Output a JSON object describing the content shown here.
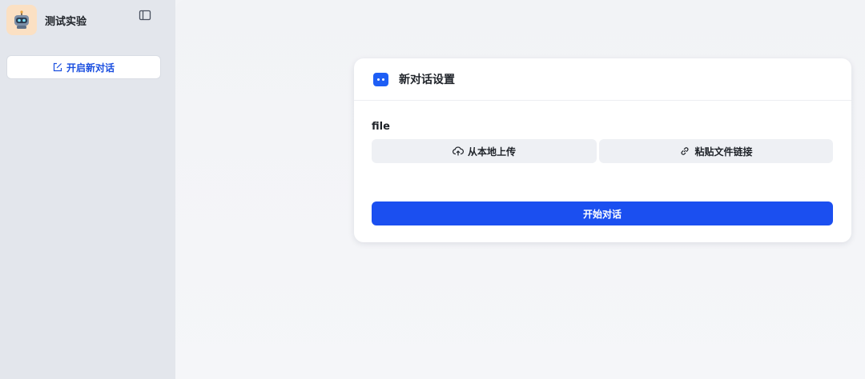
{
  "sidebar": {
    "app_title": "测试实验",
    "avatar_icon": "robot-avatar-icon",
    "collapse_icon": "sidebar-toggle-icon",
    "new_chat_label": "开启新对话",
    "new_chat_icon": "edit-icon"
  },
  "card": {
    "title": "新对话设置",
    "title_icon": "bot-icon",
    "field_label": "file",
    "upload_label": "从本地上传",
    "upload_icon": "cloud-upload-icon",
    "link_label": "粘贴文件链接",
    "link_icon": "link-icon",
    "start_label": "开始对话"
  },
  "colors": {
    "accent": "#1b4ff0",
    "sidebar_bg": "#e3e6ec",
    "avatar_bg": "#fbe0c3"
  }
}
